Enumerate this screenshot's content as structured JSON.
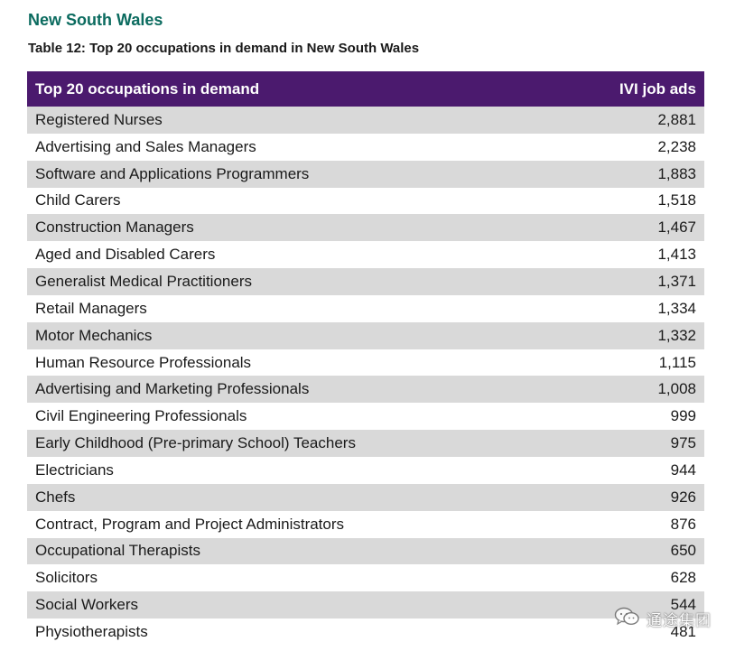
{
  "section_heading": "New South Wales",
  "table_caption": "Table 12: Top 20 occupations in demand in New South Wales",
  "table": {
    "headers": [
      "Top 20 occupations in demand",
      "IVI job ads"
    ],
    "rows": [
      {
        "occupation": "Registered Nurses",
        "ads": "2,881"
      },
      {
        "occupation": "Advertising and Sales Managers",
        "ads": "2,238"
      },
      {
        "occupation": "Software and Applications Programmers",
        "ads": "1,883"
      },
      {
        "occupation": "Child Carers",
        "ads": "1,518"
      },
      {
        "occupation": "Construction Managers",
        "ads": "1,467"
      },
      {
        "occupation": "Aged and Disabled Carers",
        "ads": "1,413"
      },
      {
        "occupation": "Generalist Medical Practitioners",
        "ads": "1,371"
      },
      {
        "occupation": "Retail Managers",
        "ads": "1,334"
      },
      {
        "occupation": "Motor Mechanics",
        "ads": "1,332"
      },
      {
        "occupation": "Human Resource Professionals",
        "ads": "1,115"
      },
      {
        "occupation": "Advertising and Marketing Professionals",
        "ads": "1,008"
      },
      {
        "occupation": "Civil Engineering Professionals",
        "ads": "999"
      },
      {
        "occupation": "Early Childhood (Pre-primary School) Teachers",
        "ads": "975"
      },
      {
        "occupation": "Electricians",
        "ads": "944"
      },
      {
        "occupation": "Chefs",
        "ads": "926"
      },
      {
        "occupation": "Contract, Program and Project Administrators",
        "ads": "876"
      },
      {
        "occupation": "Occupational Therapists",
        "ads": "650"
      },
      {
        "occupation": "Solicitors",
        "ads": "628"
      },
      {
        "occupation": "Social Workers",
        "ads": "544"
      },
      {
        "occupation": "Physiotherapists",
        "ads": "481"
      }
    ]
  },
  "colors": {
    "heading": "#0b6b5f",
    "header_bg": "#4b1a6e",
    "stripe": "#d9d9d9"
  },
  "watermark": {
    "icon": "wechat-icon",
    "text": "通途集团"
  }
}
